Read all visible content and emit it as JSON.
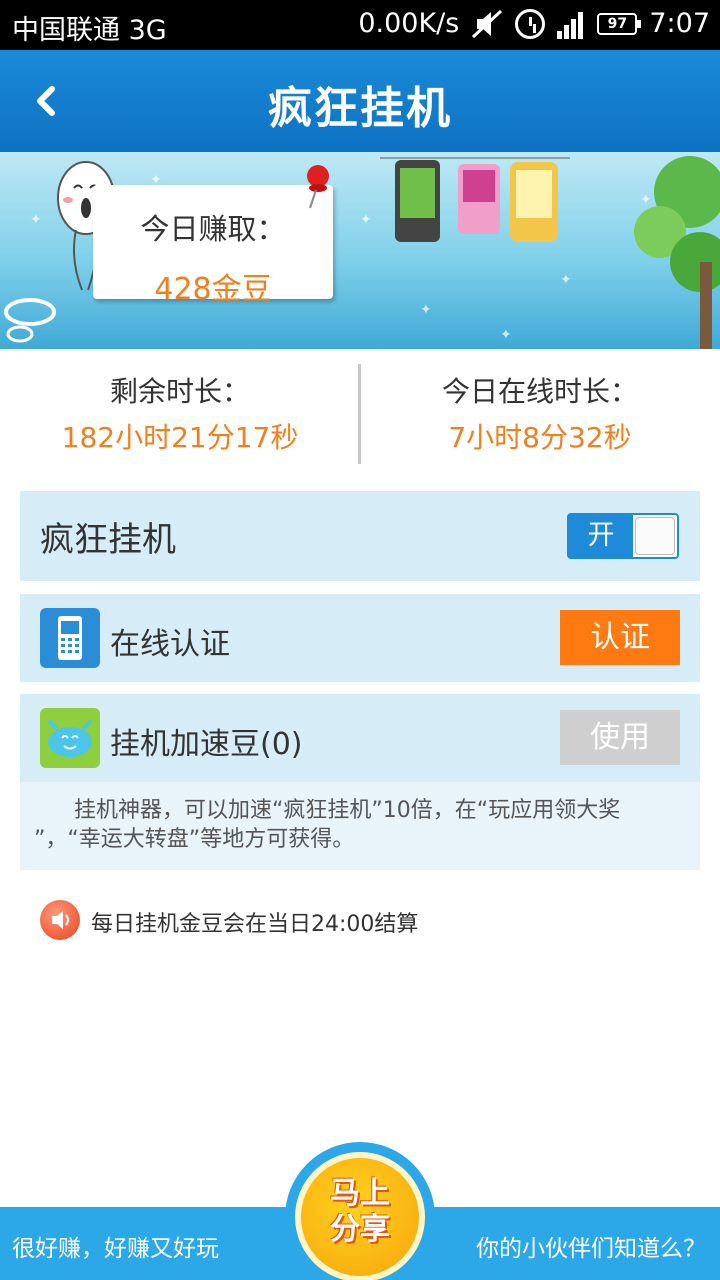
{
  "status_bar": {
    "carrier": "中国联通 3G",
    "speed": "0.00K/s",
    "battery": "97",
    "time": "7:07",
    "icons": [
      "mute-icon",
      "alarm-icon",
      "signal-icon",
      "battery-icon"
    ]
  },
  "header": {
    "title": "疯狂挂机",
    "back_icon": "back-arrow-icon"
  },
  "banner": {
    "earn_label": "今日赚取：",
    "earn_value": "428金豆"
  },
  "stats": {
    "remaining_label": "剩余时长：",
    "remaining_value": "182小时21分17秒",
    "online_label": "今日在线时长：",
    "online_value": "7小时8分32秒"
  },
  "crazy_row": {
    "title": "疯狂挂机",
    "toggle_label": "开",
    "toggle_state": "on"
  },
  "auth_row": {
    "icon": "mobile-phone-icon",
    "label": "在线认证",
    "button": "认证"
  },
  "bean_row": {
    "icon": "bean-icon",
    "label": "挂机加速豆(0)",
    "button": "使用",
    "description_line1": "挂机神器，可以加速“疯狂挂机”10倍，在“玩应用领大奖",
    "description_line2": "”，“幸运大转盘”等地方可获得。"
  },
  "notice": {
    "icon": "speaker-icon",
    "text": "每日挂机金豆会在当日24:00结算"
  },
  "bottom": {
    "left_text": "很好赚，好赚又好玩",
    "right_text": "你的小伙伴们知道么？",
    "share_line1": "马上",
    "share_line2": "分享"
  },
  "colors": {
    "title_bar": "#0d72c2",
    "accent_orange": "#f07f1c",
    "auth_button": "#ff7a10",
    "row_bg": "#d6ecf6",
    "bottom_bar": "#2ca8e8"
  }
}
